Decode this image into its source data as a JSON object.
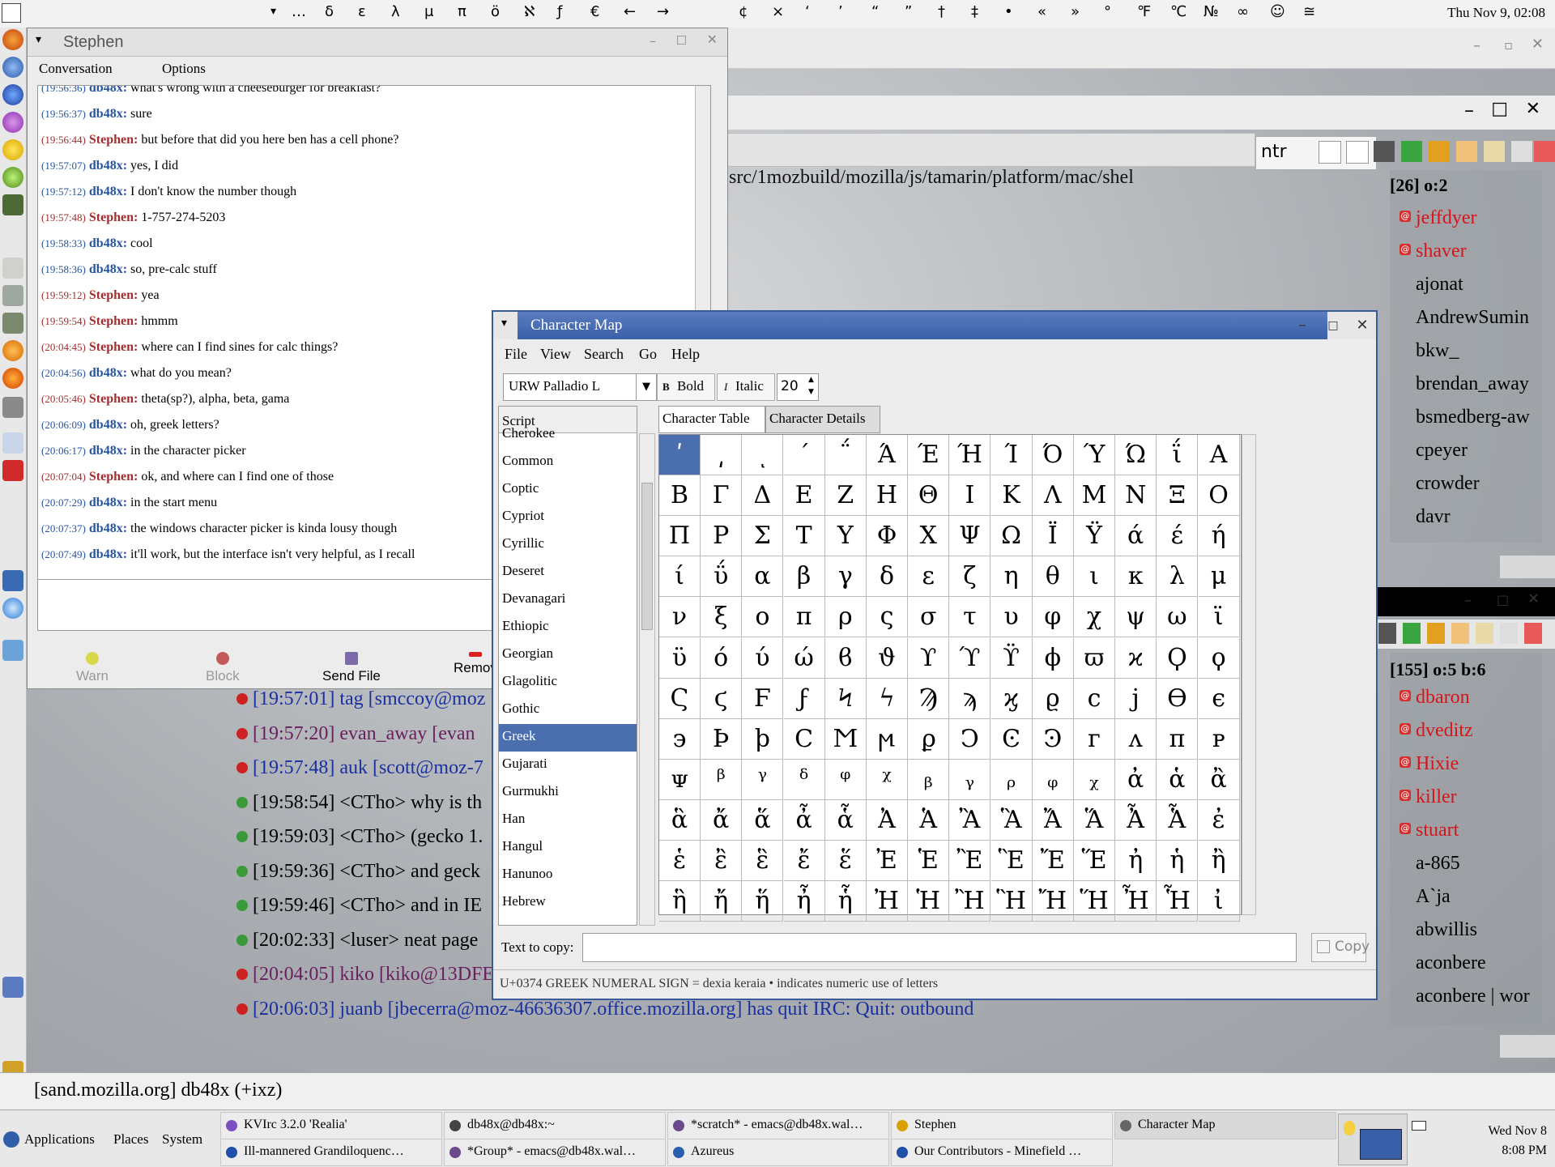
{
  "top_panel": {
    "symbols": [
      "…",
      "δ",
      "ε",
      "λ",
      "μ",
      "π",
      "ö",
      "ℵ",
      "ƒ",
      "€",
      "←",
      "→",
      "¢",
      "×",
      "‘",
      "’",
      "“",
      "”",
      "†",
      "‡",
      "•",
      "«",
      "»",
      "°",
      "℉",
      "℃",
      "№",
      "∞",
      "☺",
      "≅"
    ],
    "clock": "Thu Nov  9, 02:08"
  },
  "conversation": {
    "title": "Stephen",
    "menu": [
      "Conversation",
      "Options"
    ],
    "messages": [
      {
        "time": "(19:56:36)",
        "nick": "db48x:",
        "text": "what's wrong with a cheeseburger for breakfast?",
        "who": "me"
      },
      {
        "time": "(19:56:37)",
        "nick": "db48x:",
        "text": "sure",
        "who": "me"
      },
      {
        "time": "(19:56:44)",
        "nick": "Stephen:",
        "text": "but before that did you here ben has a cell phone?",
        "who": "them"
      },
      {
        "time": "(19:57:07)",
        "nick": "db48x:",
        "text": "yes, I did",
        "who": "me"
      },
      {
        "time": "(19:57:12)",
        "nick": "db48x:",
        "text": "I don't know the number though",
        "who": "me"
      },
      {
        "time": "(19:57:48)",
        "nick": "Stephen:",
        "text": "1-757-274-5203",
        "who": "them"
      },
      {
        "time": "(19:58:33)",
        "nick": "db48x:",
        "text": "cool",
        "who": "me"
      },
      {
        "time": "(19:58:36)",
        "nick": "db48x:",
        "text": "so, pre-calc stuff",
        "who": "me"
      },
      {
        "time": "(19:59:12)",
        "nick": "Stephen:",
        "text": "yea",
        "who": "them"
      },
      {
        "time": "(19:59:54)",
        "nick": "Stephen:",
        "text": "hmmm",
        "who": "them"
      },
      {
        "time": "(20:04:45)",
        "nick": "Stephen:",
        "text": "where can I find sines for calc things?",
        "who": "them"
      },
      {
        "time": "(20:04:56)",
        "nick": "db48x:",
        "text": "what do you mean?",
        "who": "me"
      },
      {
        "time": "(20:05:46)",
        "nick": "Stephen:",
        "text": "theta(sp?), alpha, beta,  gama",
        "who": "them"
      },
      {
        "time": "(20:06:09)",
        "nick": "db48x:",
        "text": "oh, greek letters?",
        "who": "me"
      },
      {
        "time": "(20:06:17)",
        "nick": "db48x:",
        "text": "in the character picker",
        "who": "me"
      },
      {
        "time": "(20:07:04)",
        "nick": "Stephen:",
        "text": "ok, and where can I find one of those",
        "who": "them"
      },
      {
        "time": "(20:07:29)",
        "nick": "db48x:",
        "text": "in the start menu",
        "who": "me"
      },
      {
        "time": "(20:07:37)",
        "nick": "db48x:",
        "text": "the windows character picker is kinda lousy though",
        "who": "me"
      },
      {
        "time": "(20:07:49)",
        "nick": "db48x:",
        "text": "it'll work, but the interface isn't very helpful, as I recall",
        "who": "me"
      }
    ],
    "buttons": [
      "Warn",
      "Block",
      "Send File",
      "Remov"
    ]
  },
  "kvirc": {
    "path": "src/1mozbuild/mozilla/js/tamarin/platform/mac/shel",
    "channel_input": "ntr",
    "list1_header": "[26] o:2",
    "list1": [
      {
        "name": "jeffdyer",
        "op": true
      },
      {
        "name": "shaver",
        "op": true
      },
      {
        "name": "ajonat",
        "op": false
      },
      {
        "name": "AndrewSumin",
        "op": false
      },
      {
        "name": "bkw_",
        "op": false
      },
      {
        "name": "brendan_away",
        "op": false
      },
      {
        "name": "bsmedberg-aw",
        "op": false
      },
      {
        "name": "cpeyer",
        "op": false
      },
      {
        "name": "crowder",
        "op": false
      },
      {
        "name": "davr",
        "op": false
      }
    ],
    "list2_header": "[155] o:5 b:6",
    "list2": [
      {
        "name": "dbaron",
        "op": true
      },
      {
        "name": "dveditz",
        "op": true
      },
      {
        "name": "Hixie",
        "op": true
      },
      {
        "name": "killer",
        "op": true
      },
      {
        "name": "stuart",
        "op": true
      },
      {
        "name": "a-865",
        "op": false
      },
      {
        "name": "A`ja",
        "op": false
      },
      {
        "name": "abwillis",
        "op": false
      },
      {
        "name": "aconbere",
        "op": false
      },
      {
        "name": "aconbere | wor",
        "op": false
      }
    ],
    "chat_lines": [
      {
        "text": "[19:57:01] tag [smccoy@moz",
        "color": "#1a2fa0"
      },
      {
        "text": "[19:57:20] evan_away [evan",
        "color": "#6a2060"
      },
      {
        "text": "[19:57:48] auk [scott@moz-7",
        "color": "#1a2fa0"
      },
      {
        "text": "[19:58:54] <CTho> why is th",
        "color": "#000"
      },
      {
        "text": "[19:59:03] <CTho> (gecko 1.",
        "color": "#000"
      },
      {
        "text": "[19:59:36] <CTho> and geck",
        "color": "#000"
      },
      {
        "text": "[19:59:46] <CTho> and in IE",
        "color": "#000"
      },
      {
        "text": "[20:02:33] <luser> neat page",
        "color": "#000"
      },
      {
        "text": "[20:04:05] kiko [kiko@13DFE",
        "color": "#6a2060"
      },
      {
        "text": "[20:06:03] juanb [jbecerra@moz-46636307.office.mozilla.org] has quit IRC: Quit: outbound",
        "color": "#1a2fa0"
      }
    ],
    "status": "[sand.mozilla.org] db48x (+ixz)"
  },
  "charmap": {
    "title": "Character Map",
    "menu": [
      "File",
      "View",
      "Search",
      "Go",
      "Help"
    ],
    "font": "URW Palladio L",
    "bold": "Bold",
    "italic": "Italic",
    "size": "20",
    "script_header": "Script",
    "scripts": [
      "Cherokee",
      "Common",
      "Coptic",
      "Cypriot",
      "Cyrillic",
      "Deseret",
      "Devanagari",
      "Ethiopic",
      "Georgian",
      "Glagolitic",
      "Gothic",
      "Greek",
      "Gujarati",
      "Gurmukhi",
      "Han",
      "Hangul",
      "Hanunoo",
      "Hebrew"
    ],
    "selected_script": "Greek",
    "tabs": [
      "Character Table",
      "Character Details"
    ],
    "rows": [
      [
        "ʹ",
        "͵",
        "ͺ",
        "΄",
        "΅",
        "Ά",
        "Έ",
        "Ή",
        "Ί",
        "Ό",
        "Ύ",
        "Ώ",
        "ΐ",
        "Α"
      ],
      [
        "Β",
        "Γ",
        "Δ",
        "Ε",
        "Ζ",
        "Η",
        "Θ",
        "Ι",
        "Κ",
        "Λ",
        "Μ",
        "Ν",
        "Ξ",
        "Ο"
      ],
      [
        "Π",
        "Ρ",
        "Σ",
        "Τ",
        "Υ",
        "Φ",
        "Χ",
        "Ψ",
        "Ω",
        "Ϊ",
        "Ϋ",
        "ά",
        "έ",
        "ή"
      ],
      [
        "ί",
        "ΰ",
        "α",
        "β",
        "γ",
        "δ",
        "ε",
        "ζ",
        "η",
        "θ",
        "ι",
        "κ",
        "λ",
        "μ"
      ],
      [
        "ν",
        "ξ",
        "ο",
        "π",
        "ρ",
        "ς",
        "σ",
        "τ",
        "υ",
        "φ",
        "χ",
        "ψ",
        "ω",
        "ϊ"
      ],
      [
        "ϋ",
        "ό",
        "ύ",
        "ώ",
        "ϐ",
        "ϑ",
        "ϒ",
        "ϓ",
        "ϔ",
        "ϕ",
        "ϖ",
        "ϰ",
        "Ϙ",
        "ϙ"
      ],
      [
        "Ϛ",
        "ϛ",
        "Ϝ",
        "ϝ",
        "Ϟ",
        "ϟ",
        "Ϡ",
        "ϡ",
        "ϗ",
        "ϱ",
        "ϲ",
        "ϳ",
        "ϴ",
        "ϵ"
      ],
      [
        "϶",
        "Ϸ",
        "ϸ",
        "Ϲ",
        "Ϻ",
        "ϻ",
        "ϼ",
        "Ͻ",
        "Ͼ",
        "Ͽ",
        "ᴦ",
        "ᴧ",
        "ᴨ",
        "ᴩ"
      ],
      [
        "ᴪ",
        "ᵝ",
        "ᵞ",
        "ᵟ",
        "ᵠ",
        "ᵡ",
        "ᵦ",
        "ᵧ",
        "ᵨ",
        "ᵩ",
        "ᵪ",
        "ἀ",
        "ἁ",
        "ἂ"
      ],
      [
        "ἃ",
        "ἄ",
        "ἅ",
        "ἆ",
        "ἇ",
        "Ἀ",
        "Ἁ",
        "Ἂ",
        "Ἃ",
        "Ἄ",
        "Ἅ",
        "Ἆ",
        "Ἇ",
        "ἐ"
      ],
      [
        "ἑ",
        "ἒ",
        "ἓ",
        "ἔ",
        "ἕ",
        "Ἐ",
        "Ἑ",
        "Ἒ",
        "Ἓ",
        "Ἔ",
        "Ἕ",
        "ἠ",
        "ἡ",
        "ἢ"
      ],
      [
        "ἣ",
        "ἤ",
        "ἥ",
        "ἦ",
        "ἧ",
        "Ἠ",
        "Ἡ",
        "Ἢ",
        "Ἣ",
        "Ἤ",
        "Ἥ",
        "Ἦ",
        "Ἧ",
        "ἰ"
      ]
    ],
    "copy_label": "Text to copy:",
    "copy_button": "Copy",
    "status": "U+0374 GREEK NUMERAL SIGN   = dexia keraia   • indicates numeric use of letters"
  },
  "taskbar": {
    "menus": [
      "Applications",
      "Places",
      "System"
    ],
    "tasks_row1": [
      {
        "label": "KVIrc 3.2.0 'Realia'",
        "color": "#7a4fc2"
      },
      {
        "label": "db48x@db48x:~",
        "color": "#444"
      },
      {
        "label": "*scratch* - emacs@db48x.wal…",
        "color": "#6a4a8a"
      },
      {
        "label": "Stephen",
        "color": "#d8a000"
      },
      {
        "label": "Character Map",
        "color": "#666",
        "active": true
      }
    ],
    "tasks_row2": [
      {
        "label": "Ill-mannered Grandiloquenc…",
        "color": "#1f4fa8"
      },
      {
        "label": "*Group* - emacs@db48x.wal…",
        "color": "#6a4a8a"
      },
      {
        "label": "Azureus",
        "color": "#2a5fb0"
      },
      {
        "label": "Our Contributors - Minefield …",
        "color": "#1f4fa8"
      }
    ],
    "clock_line1": "Wed Nov  8",
    "clock_line2": "8:08 PM"
  }
}
